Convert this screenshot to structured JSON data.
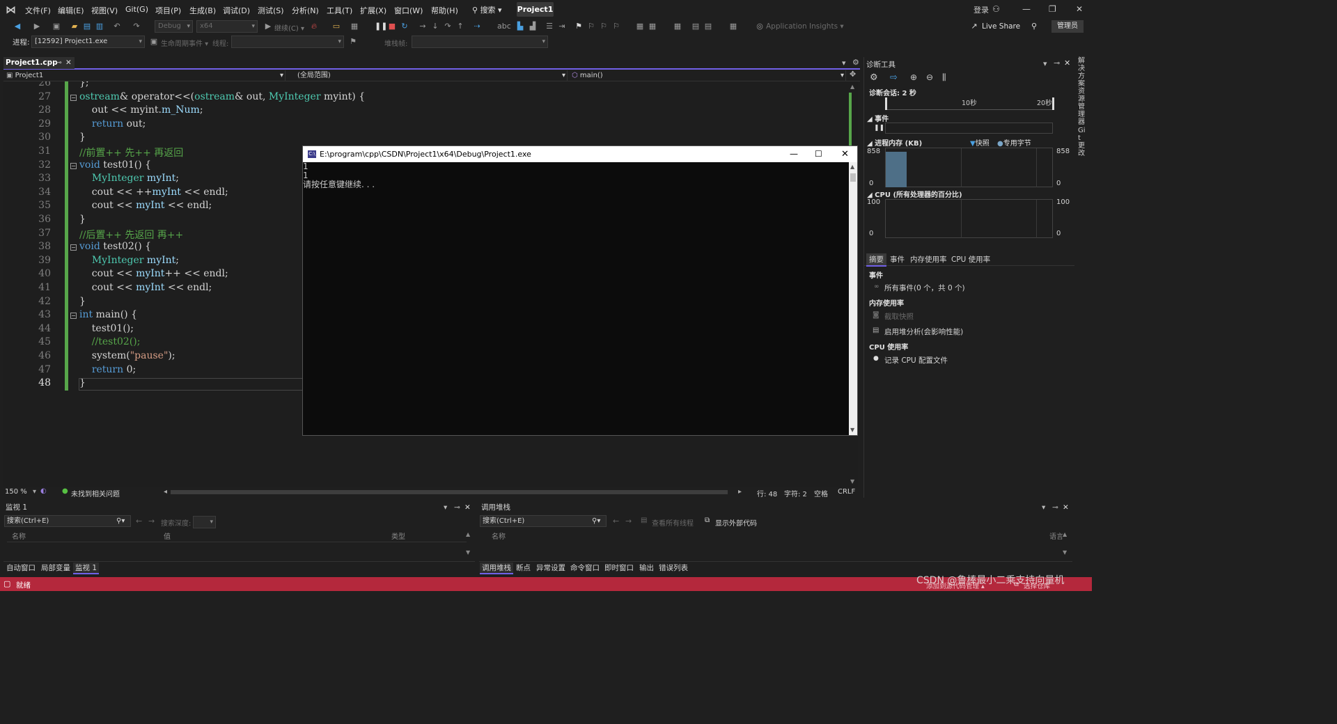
{
  "menubar": {
    "items": [
      "文件(F)",
      "编辑(E)",
      "视图(V)",
      "Git(G)",
      "项目(P)",
      "生成(B)",
      "调试(D)",
      "测试(S)",
      "分析(N)",
      "工具(T)",
      "扩展(X)",
      "窗口(W)",
      "帮助(H)"
    ],
    "search": "搜索 ▾",
    "project": "Project1",
    "login": "登录"
  },
  "toolbar1": {
    "config": "Debug",
    "platform": "x64",
    "continue": "继续(C) ▾",
    "app_insights": "Application Insights ▾",
    "live_share": "Live Share",
    "admin": "管理员"
  },
  "toolbar2": {
    "process_label": "进程:",
    "process_value": "[12592] Project1.exe",
    "lifecycle": "生命周期事件 ▾",
    "thread_label": "线程:",
    "stackframe_label": "堆栈帧:"
  },
  "editor": {
    "tab_title": "Project1.cpp",
    "nav_project": "Project1",
    "nav_scope": "(全局范围)",
    "nav_member": "main()",
    "lines": [
      {
        "n": "26",
        "html": "<span>};</span>"
      },
      {
        "n": "27",
        "text": "ostream& operator<<(ostream& out, MyInteger myint) {"
      },
      {
        "n": "28",
        "text": "    out << myint.m_Num;"
      },
      {
        "n": "29",
        "text": "    return out;"
      },
      {
        "n": "30",
        "text": "}"
      },
      {
        "n": "31",
        "text": "//前置++ 先++ 再返回"
      },
      {
        "n": "32",
        "text": "void test01() {"
      },
      {
        "n": "33",
        "text": "    MyInteger myInt;"
      },
      {
        "n": "34",
        "text": "    cout << ++myInt << endl;"
      },
      {
        "n": "35",
        "text": "    cout << myInt << endl;"
      },
      {
        "n": "36",
        "text": "}"
      },
      {
        "n": "37",
        "text": "//后置++ 先返回 再++"
      },
      {
        "n": "38",
        "text": "void test02() {"
      },
      {
        "n": "39",
        "text": "    MyInteger myInt;"
      },
      {
        "n": "40",
        "text": "    cout << myInt++ << endl;"
      },
      {
        "n": "41",
        "text": "    cout << myInt << endl;"
      },
      {
        "n": "42",
        "text": "}"
      },
      {
        "n": "43",
        "text": "int main() {"
      },
      {
        "n": "44",
        "text": "    test01();"
      },
      {
        "n": "45",
        "text": "    //test02();"
      },
      {
        "n": "46",
        "text": "    system(\"pause\");"
      },
      {
        "n": "47",
        "text": "    return 0;"
      },
      {
        "n": "48",
        "text": "}"
      }
    ],
    "zoom": "150 %",
    "issues": "未找到相关问题",
    "line": "行: 48",
    "char": "字符: 2",
    "spaces": "空格",
    "eol": "CRLF"
  },
  "console": {
    "title": "E:\\program\\cpp\\CSDN\\Project1\\x64\\Debug\\Project1.exe",
    "output": [
      "1",
      "1",
      "请按任意键继续. . ."
    ]
  },
  "diag": {
    "title": "诊断工具",
    "session": "诊断会话: 2 秒",
    "t10": "10秒",
    "t20": "20秒",
    "events": "事件",
    "memory": "进程内存 (KB)",
    "snapshot": "快照",
    "private_bytes": "专用字节",
    "mem_max": "858",
    "mem_min": "0",
    "cpu": "CPU (所有处理器的百分比)",
    "cpu_max": "100",
    "cpu_min": "0",
    "tabs": [
      "摘要",
      "事件",
      "内存使用率",
      "CPU 使用率"
    ],
    "sec_events": "事件",
    "all_events": "所有事件(0 个，共 0 个)",
    "sec_memory": "内存使用率",
    "take_snapshot": "截取快照",
    "heap_analysis": "启用堆分析(会影响性能)",
    "sec_cpu": "CPU 使用率",
    "record_cpu": "记录 CPU 配置文件"
  },
  "watch": {
    "title": "监视 1",
    "search": "搜索(Ctrl+E)",
    "depth": "搜索深度:",
    "cols": [
      "名称",
      "值",
      "类型"
    ],
    "tabs": [
      "自动窗口",
      "局部变量",
      "监视 1"
    ]
  },
  "callstack": {
    "title": "调用堆栈",
    "search": "搜索(Ctrl+E)",
    "view_threads": "查看所有线程",
    "external": "显示外部代码",
    "cols": [
      "名称",
      "语言"
    ],
    "tabs": [
      "调用堆栈",
      "断点",
      "异常设置",
      "命令窗口",
      "即时窗口",
      "输出",
      "错误列表"
    ]
  },
  "statusbar": {
    "ready": "就绪",
    "add_source": "添加到源代码管理 ▴",
    "select_repo": "选择仓库",
    "watermark": "CSDN @鲁棒最小二乘支持向量机"
  },
  "right_strip": {
    "solution_explorer": "解决方案资源管理器",
    "git_changes": "Git 更改"
  }
}
